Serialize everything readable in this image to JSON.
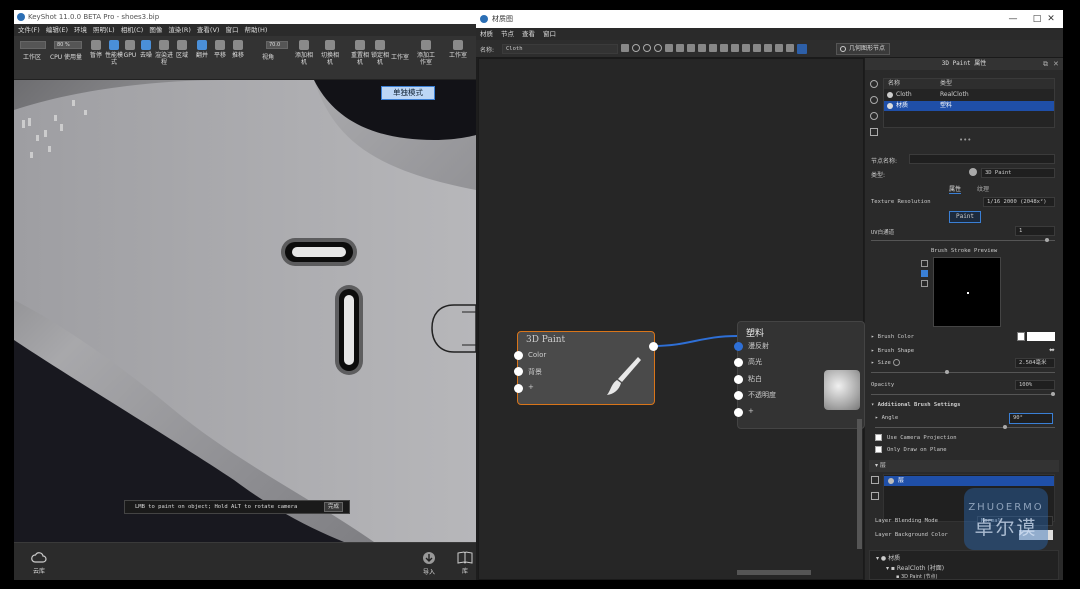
{
  "keyshot": {
    "title": "KeyShot 11.0.0 BETA Pro - shoes3.bip",
    "menu": [
      "文件(F)",
      "编辑(E)",
      "环境",
      "照明(L)",
      "相机(C)",
      "图像",
      "渲染(R)",
      "查看(V)",
      "窗口",
      "帮助(H)"
    ],
    "toolbar": {
      "field1": "",
      "field2": "80 %",
      "field3": "70.0",
      "buttons": [
        "工作区",
        "CPU 使用量",
        "暂停",
        "性能模式",
        "GPU",
        "去噪",
        "渲染进程",
        "区域",
        "翻并",
        "平移",
        "推移",
        "视角",
        "添加相机",
        "切换相机",
        "重置相机",
        "锁定相机",
        "工作室",
        "添加工作室",
        "工作室"
      ]
    },
    "mode_badge": "单独模式",
    "status_msg": "LMB to paint on object; Hold ALT to rotate camera",
    "done_label": "完成",
    "bottom": {
      "cloud": "云库",
      "import": "导入",
      "library": "库"
    }
  },
  "material_editor": {
    "title": "材质图",
    "menu": [
      "材质",
      "节点",
      "查看",
      "窗口"
    ],
    "name_label": "名称:",
    "name_value": "Cloth",
    "geo_btn": "几何图形节点",
    "node_paint": {
      "title": "3D Paint",
      "ports": [
        "Color",
        "背景",
        "+"
      ]
    },
    "node_material": {
      "title": "塑料",
      "ports": [
        "漫反射",
        "高光",
        "粘白",
        "不透明度",
        "+"
      ]
    }
  },
  "properties": {
    "title": "3D Paint 属性",
    "table_headers": [
      "名称",
      "类型"
    ],
    "rows": [
      {
        "name": "Cloth",
        "type": "RealCloth"
      },
      {
        "name": "材质",
        "type": "塑料"
      }
    ],
    "node_name_label": "节点名称:",
    "type_label": "类型:",
    "type_value": "3D Paint",
    "tabs": [
      "属性",
      "纹理"
    ],
    "texture_res_label": "Texture Resolution",
    "texture_res_value": "1/16 2000 (2048x²)",
    "paint_btn": "Paint",
    "uv_label": "UV白通道",
    "uv_value": "1",
    "brush_preview_label": "Brush Stroke Preview",
    "brush_color_label": "Brush Color",
    "brush_shape_label": "Brush Shape",
    "size_label": "Size",
    "size_value": "2.504毫米",
    "opacity_label": "Opacity",
    "opacity_value": "100%",
    "additional_label": "Additional Brush Settings",
    "angle_label": "Angle",
    "angle_value": "90°",
    "camera_proj_label": "Use Camera Projection",
    "draw_plane_label": "Only Draw on Plane",
    "layers_label": "层",
    "layer_item": "层",
    "blend_label": "Layer Blending Mode",
    "blend_value": "Normal",
    "bg_color_label": "Layer Background Color",
    "tree_root": "材质",
    "tree_child": "RealCloth (衬面)",
    "tree_grandchild": "3D Paint (节点)"
  },
  "watermark": {
    "text": "卓尔谟",
    "sub": "ZHUOERMO"
  },
  "colors": {
    "accent": "#3a7fd5",
    "node_border": "#d9751a",
    "selection": "#1f4fa8",
    "link": "#2e6fd6"
  }
}
